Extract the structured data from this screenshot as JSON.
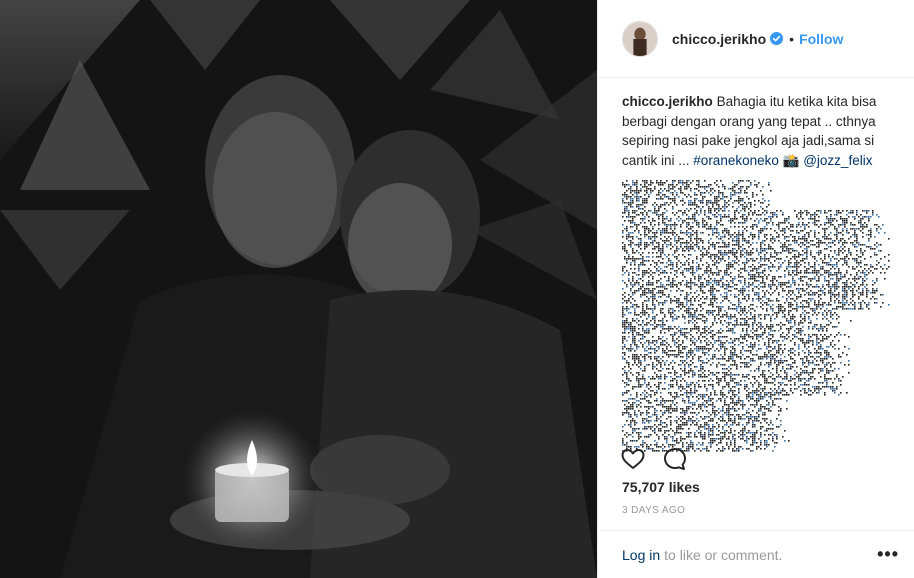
{
  "post": {
    "username": "chicco.jerikho",
    "separator": "•",
    "follow_label": "Follow",
    "caption_user": "chicco.jerikho",
    "caption_text": "Bahagia itu ketika kita bisa berbagi dengan orang yang tepat .. cthnya sepiring nasi pake jengkol aja jadi,sama si cantik ini ...",
    "hashtag": "#oranekoneko",
    "emoji": "📸",
    "mention": "@jozz_felix",
    "likes": "75,707 likes",
    "timestamp": "3 DAYS AGO",
    "login_link": "Log in",
    "login_suffix": "to like or comment.",
    "more_options": "•••"
  },
  "colors": {
    "link_blue": "#3897f0",
    "dark_link": "#003569",
    "muted": "#999999",
    "text": "#262626"
  },
  "icons": [
    "verified-badge-icon",
    "heart-icon",
    "comment-icon",
    "more-options-icon"
  ]
}
